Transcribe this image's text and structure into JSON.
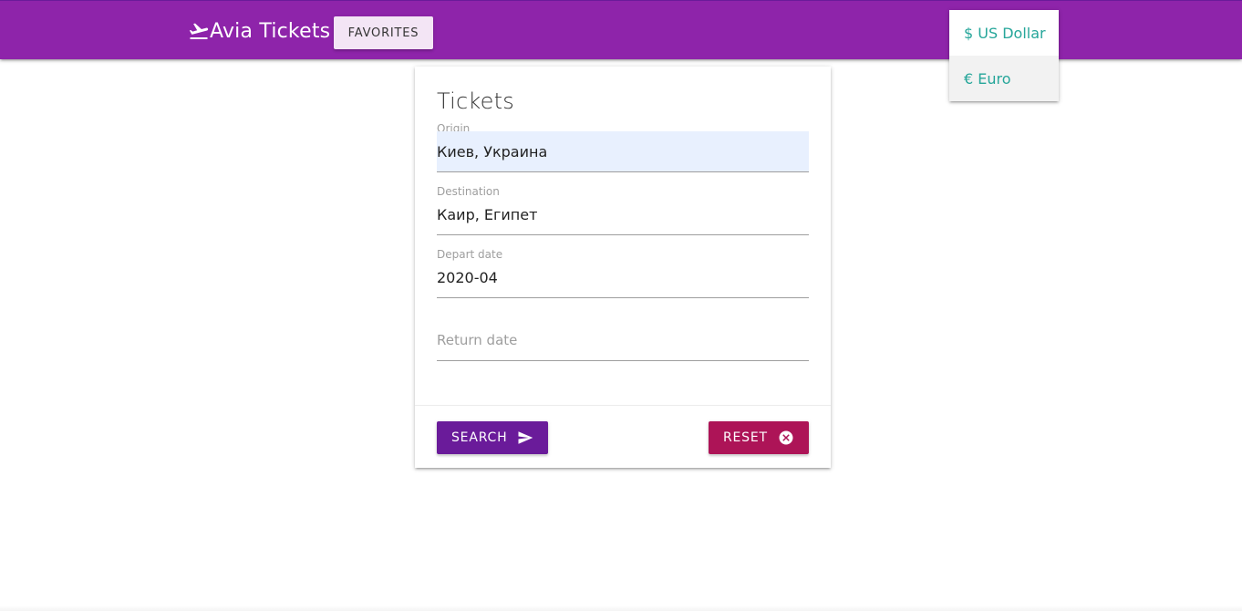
{
  "navbar": {
    "brand_text": "Avia Tickets",
    "brand_icon": "airplane-takeoff-icon",
    "favorites_label": "Favorites",
    "bg_color": "#8e24aa"
  },
  "currency_dropdown": {
    "items": [
      {
        "label": "$ US Dollar"
      },
      {
        "label": "€ Euro"
      }
    ],
    "item_color": "#26a69a"
  },
  "form": {
    "title": "Tickets",
    "origin": {
      "label": "Origin",
      "value": "Киев, Украина"
    },
    "destination": {
      "label": "Destination",
      "value": "Каир, Египет"
    },
    "depart": {
      "label": "Depart date",
      "value": "2020-04"
    },
    "return": {
      "placeholder": "Return date"
    },
    "search_label": "Search",
    "reset_label": "Reset",
    "search_color": "#6a1b9a",
    "reset_color": "#ad1457"
  }
}
